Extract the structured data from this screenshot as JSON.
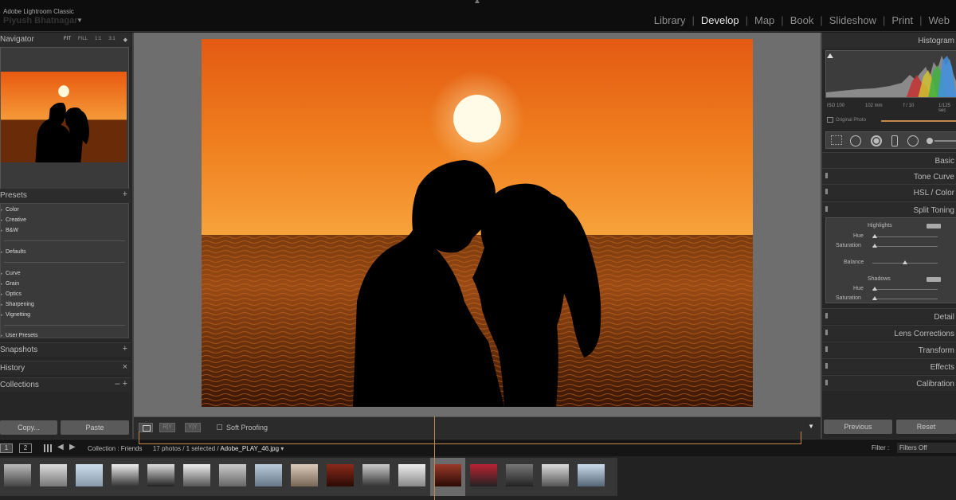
{
  "topbar": {
    "app_name": "Adobe Lightroom Classic",
    "user_name": "Piyush Bhatnagar",
    "modules": [
      {
        "label": "Library",
        "active": false
      },
      {
        "label": "Develop",
        "active": true
      },
      {
        "label": "Map",
        "active": false
      },
      {
        "label": "Book",
        "active": false
      },
      {
        "label": "Slideshow",
        "active": false
      },
      {
        "label": "Print",
        "active": false
      },
      {
        "label": "Web",
        "active": false
      }
    ]
  },
  "left_panel": {
    "navigator": {
      "title": "Navigator",
      "zoom_options": [
        "FIT",
        "FILL",
        "1:1",
        "3:1"
      ],
      "zoom_active": "FIT"
    },
    "presets": {
      "title": "Presets",
      "add": "+",
      "items": [
        "Color",
        "Creative",
        "B&W",
        "Defaults",
        "Curve",
        "Grain",
        "Optics",
        "Sharpening",
        "Vignetting",
        "User Presets"
      ]
    },
    "snapshots": {
      "title": "Snapshots",
      "action": "+"
    },
    "history": {
      "title": "History",
      "action": "×"
    },
    "collections": {
      "title": "Collections",
      "action": "– +"
    },
    "copy_label": "Copy...",
    "paste_label": "Paste"
  },
  "toolbar": {
    "soft_proofing": "Soft Proofing",
    "ry_label": "R|Y",
    "yy_label": "Y|Y"
  },
  "right_panel": {
    "histogram": {
      "title": "Histogram",
      "info": [
        "ISO 100",
        "102 mm",
        "f / 10",
        "1/125 sec"
      ],
      "original_photo": "Original Photo"
    },
    "sections": [
      "Basic",
      "Tone Curve",
      "HSL / Color",
      "Split Toning",
      "Detail",
      "Lens Corrections",
      "Transform",
      "Effects",
      "Calibration"
    ],
    "split_toning": {
      "highlights": "Highlights",
      "shadows": "Shadows",
      "hue": "Hue",
      "saturation": "Saturation",
      "balance": "Balance",
      "highlights_hue": 0,
      "highlights_saturation": 0,
      "balance_value": 0,
      "shadows_hue": 0,
      "shadows_saturation": 0
    },
    "previous_label": "Previous",
    "reset_label": "Reset"
  },
  "filmstrip": {
    "page_1": "1",
    "page_2": "2",
    "source_prefix": "Collection : Friends",
    "source_counts": "17 photos / 1 selected /",
    "filename": "Adobe_PLAY_46.jpg",
    "filter_label": "Filter :",
    "filter_value": "Filters Off",
    "thumbnail_count": 17,
    "selected_index": 12
  },
  "colors": {
    "accent": "#c0884a",
    "sky_top": "#e8641a",
    "sky_mid": "#f39a3a",
    "sea": "#5a2505"
  }
}
